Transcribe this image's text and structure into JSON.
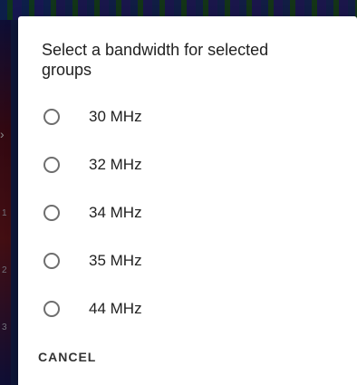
{
  "background": {
    "row_labels": [
      "1",
      "2",
      "3"
    ]
  },
  "dialog": {
    "title": "Select a bandwidth for selected groups",
    "options": [
      {
        "label": "30 MHz",
        "selected": false
      },
      {
        "label": "32 MHz",
        "selected": false
      },
      {
        "label": "34 MHz",
        "selected": false
      },
      {
        "label": "35 MHz",
        "selected": false
      },
      {
        "label": "44 MHz",
        "selected": false
      }
    ],
    "cancel_label": "CANCEL"
  },
  "colors": {
    "dialog_bg": "#ffffff",
    "text_primary": "#212121",
    "radio_border": "#6e6e6e",
    "scrim": "rgba(0,0,0,0.45)"
  }
}
